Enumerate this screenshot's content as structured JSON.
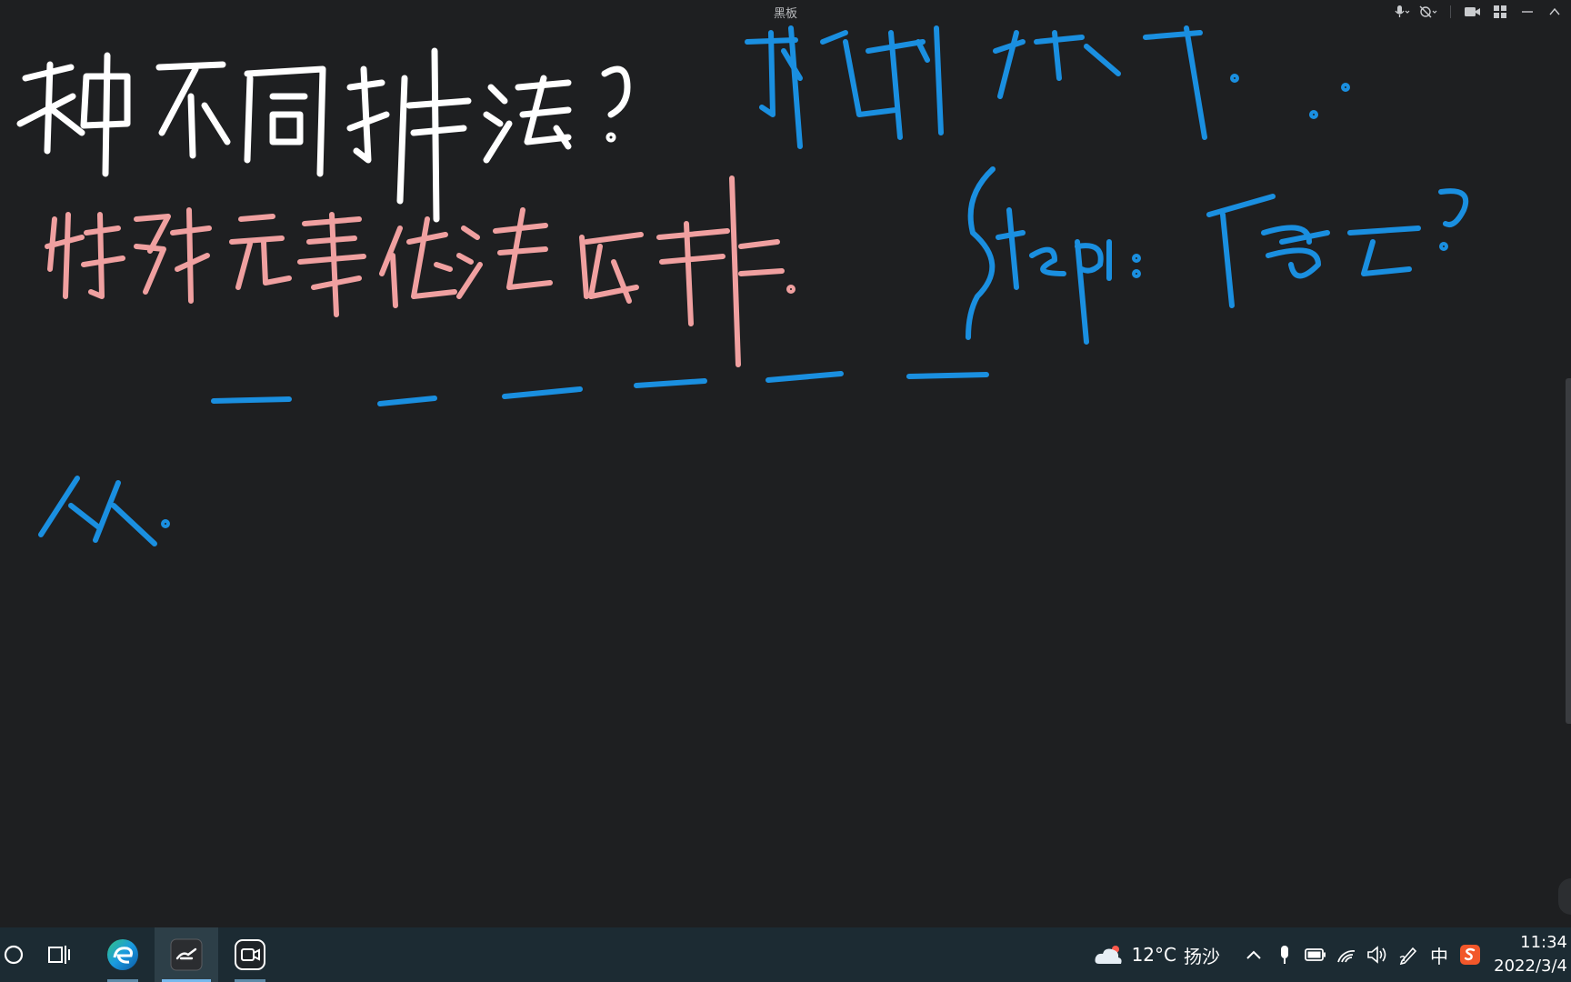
{
  "window": {
    "title": "黑板"
  },
  "board": {
    "handwriting": [
      {
        "text": "种不同排法?",
        "color": "#ffffff"
      },
      {
        "text": "特殊元素优先安排.",
        "color": "#f0a0a0"
      },
      {
        "text": "先排特殊元素",
        "color": "#1a8fe0"
      },
      {
        "text": "Step1: 谁需要?",
        "color": "#1a8fe0"
      },
      {
        "text": "从",
        "color": "#1a8fe0"
      }
    ],
    "blanks_count_label": "6"
  },
  "colors": {
    "background": "#1e1f21",
    "ink_white": "#ffffff",
    "ink_pink": "#f0a0a0",
    "ink_blue": "#1a8fe0",
    "taskbar": "#1c2b33"
  },
  "taskbar": {
    "apps": [
      {
        "name": "search-icon"
      },
      {
        "name": "task-view-icon"
      },
      {
        "name": "edge-icon"
      },
      {
        "name": "blackboard-app-icon"
      },
      {
        "name": "video-meeting-icon"
      }
    ],
    "weather": {
      "temperature": "12°C",
      "location": "扬沙"
    },
    "ime": "中",
    "clock": {
      "time": "11:34",
      "date": "2022/3/4"
    }
  }
}
